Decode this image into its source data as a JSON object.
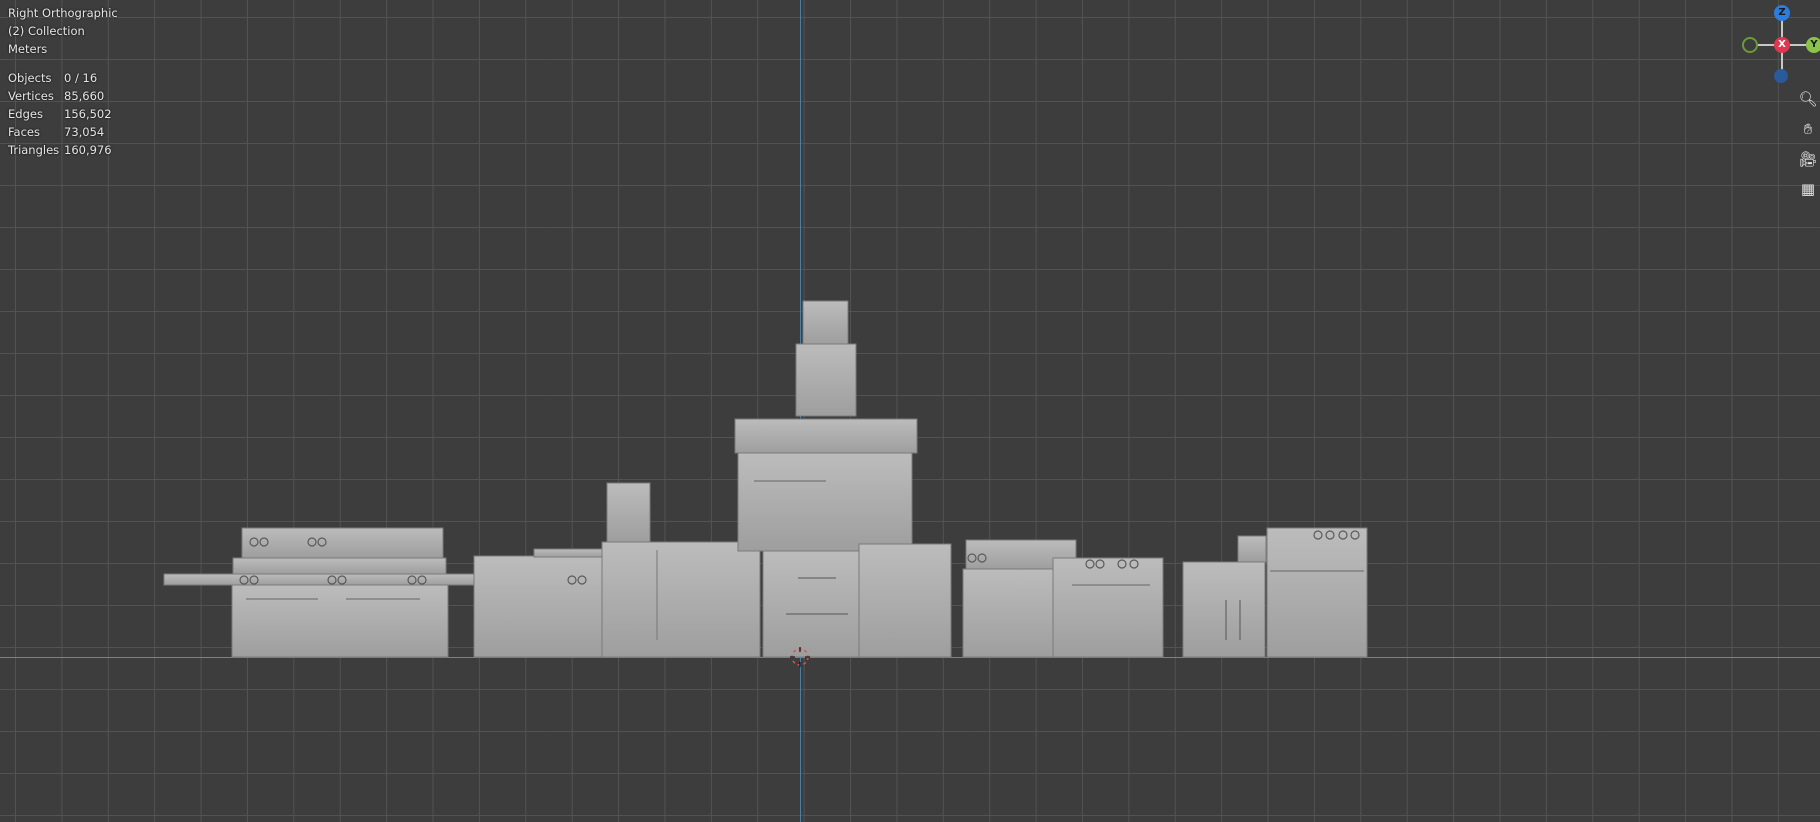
{
  "viewport": {
    "view_name": "Right Orthographic",
    "collection": "(2) Collection",
    "units": "Meters"
  },
  "stats": [
    {
      "label": "Objects",
      "value": "0 / 16"
    },
    {
      "label": "Vertices",
      "value": "85,660"
    },
    {
      "label": "Edges",
      "value": "156,502"
    },
    {
      "label": "Faces",
      "value": "73,054"
    },
    {
      "label": "Triangles",
      "value": "160,976"
    }
  ],
  "gizmo": {
    "z_label": "Z",
    "x_label": "X",
    "y_label": "Y",
    "colors": {
      "z": "#2b7de0",
      "x": "#e0364f",
      "y": "#8bc34a"
    }
  },
  "tools": [
    {
      "icon": "zoom-icon"
    },
    {
      "icon": "hand-pan-icon"
    },
    {
      "icon": "camera-icon"
    },
    {
      "icon": "grid-icon"
    }
  ]
}
